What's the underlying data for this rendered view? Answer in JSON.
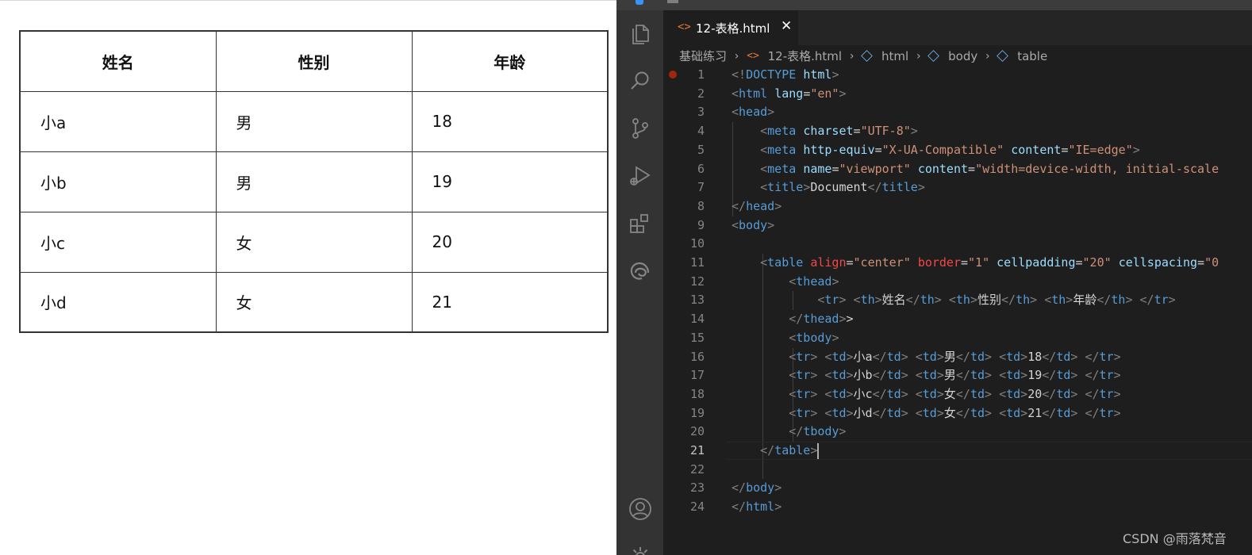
{
  "preview": {
    "table": {
      "headers": [
        "姓名",
        "性别",
        "年龄"
      ],
      "rows": [
        [
          "小a",
          "男",
          "18"
        ],
        [
          "小b",
          "男",
          "19"
        ],
        [
          "小c",
          "女",
          "20"
        ],
        [
          "小d",
          "女",
          "21"
        ]
      ]
    }
  },
  "editor": {
    "tab": {
      "label": "12-表格.html",
      "icon": "html-file-icon"
    },
    "breadcrumb": [
      "基础练习",
      "12-表格.html",
      "html",
      "body",
      "table"
    ],
    "active_line": 21,
    "lines": [
      {
        "n": "1",
        "t": [
          [
            "p",
            "<!"
          ],
          [
            "t",
            "DOCTYPE"
          ],
          [
            "x",
            " "
          ],
          [
            "a",
            "html"
          ],
          [
            "p",
            ">"
          ]
        ]
      },
      {
        "n": "2",
        "t": [
          [
            "p",
            "<"
          ],
          [
            "t",
            "html"
          ],
          [
            "x",
            " "
          ],
          [
            "a",
            "lang"
          ],
          [
            "x",
            "="
          ],
          [
            "v",
            "\"en\""
          ],
          [
            "p",
            ">"
          ]
        ]
      },
      {
        "n": "3",
        "t": [
          [
            "p",
            "<"
          ],
          [
            "t",
            "head"
          ],
          [
            "p",
            ">"
          ]
        ]
      },
      {
        "n": "4",
        "t": [
          [
            "x",
            "    "
          ],
          [
            "p",
            "<"
          ],
          [
            "t",
            "meta"
          ],
          [
            "x",
            " "
          ],
          [
            "a",
            "charset"
          ],
          [
            "x",
            "="
          ],
          [
            "v",
            "\"UTF-8\""
          ],
          [
            "p",
            ">"
          ]
        ]
      },
      {
        "n": "5",
        "t": [
          [
            "x",
            "    "
          ],
          [
            "p",
            "<"
          ],
          [
            "t",
            "meta"
          ],
          [
            "x",
            " "
          ],
          [
            "a",
            "http-equiv"
          ],
          [
            "x",
            "="
          ],
          [
            "v",
            "\"X-UA-Compatible\""
          ],
          [
            "x",
            " "
          ],
          [
            "a",
            "content"
          ],
          [
            "x",
            "="
          ],
          [
            "v",
            "\"IE=edge\""
          ],
          [
            "p",
            ">"
          ]
        ]
      },
      {
        "n": "6",
        "t": [
          [
            "x",
            "    "
          ],
          [
            "p",
            "<"
          ],
          [
            "t",
            "meta"
          ],
          [
            "x",
            " "
          ],
          [
            "a",
            "name"
          ],
          [
            "x",
            "="
          ],
          [
            "v",
            "\"viewport\""
          ],
          [
            "x",
            " "
          ],
          [
            "a",
            "content"
          ],
          [
            "x",
            "="
          ],
          [
            "v",
            "\"width=device-width, initial-scale"
          ]
        ]
      },
      {
        "n": "7",
        "t": [
          [
            "x",
            "    "
          ],
          [
            "p",
            "<"
          ],
          [
            "t",
            "title"
          ],
          [
            "p",
            ">"
          ],
          [
            "x",
            "Document"
          ],
          [
            "p",
            "</"
          ],
          [
            "t",
            "title"
          ],
          [
            "p",
            ">"
          ]
        ]
      },
      {
        "n": "8",
        "t": [
          [
            "p",
            "</"
          ],
          [
            "t",
            "head"
          ],
          [
            "p",
            ">"
          ]
        ]
      },
      {
        "n": "9",
        "t": [
          [
            "p",
            "<"
          ],
          [
            "t",
            "body"
          ],
          [
            "p",
            ">"
          ]
        ]
      },
      {
        "n": "10",
        "t": []
      },
      {
        "n": "11",
        "t": [
          [
            "x",
            "    "
          ],
          [
            "p",
            "<"
          ],
          [
            "t",
            "table"
          ],
          [
            "x",
            " "
          ],
          [
            "r",
            "align"
          ],
          [
            "x",
            "="
          ],
          [
            "v",
            "\"center\""
          ],
          [
            "x",
            " "
          ],
          [
            "r",
            "border"
          ],
          [
            "x",
            "="
          ],
          [
            "v",
            "\"1\""
          ],
          [
            "x",
            " "
          ],
          [
            "a",
            "cellpadding"
          ],
          [
            "x",
            "="
          ],
          [
            "v",
            "\"20\""
          ],
          [
            "x",
            " "
          ],
          [
            "a",
            "cellspacing"
          ],
          [
            "x",
            "="
          ],
          [
            "v",
            "\"0"
          ]
        ]
      },
      {
        "n": "12",
        "t": [
          [
            "x",
            "        "
          ],
          [
            "p",
            "<"
          ],
          [
            "t",
            "thead"
          ],
          [
            "p",
            ">"
          ]
        ]
      },
      {
        "n": "13",
        "t": [
          [
            "x",
            "            "
          ],
          [
            "p",
            "<"
          ],
          [
            "t",
            "tr"
          ],
          [
            "p",
            ">"
          ],
          [
            "x",
            " "
          ],
          [
            "p",
            "<"
          ],
          [
            "t",
            "th"
          ],
          [
            "p",
            ">"
          ],
          [
            "x",
            "姓名"
          ],
          [
            "p",
            "</"
          ],
          [
            "t",
            "th"
          ],
          [
            "p",
            ">"
          ],
          [
            "x",
            " "
          ],
          [
            "p",
            "<"
          ],
          [
            "t",
            "th"
          ],
          [
            "p",
            ">"
          ],
          [
            "x",
            "性别"
          ],
          [
            "p",
            "</"
          ],
          [
            "t",
            "th"
          ],
          [
            "p",
            ">"
          ],
          [
            "x",
            " "
          ],
          [
            "p",
            "<"
          ],
          [
            "t",
            "th"
          ],
          [
            "p",
            ">"
          ],
          [
            "x",
            "年龄"
          ],
          [
            "p",
            "</"
          ],
          [
            "t",
            "th"
          ],
          [
            "p",
            ">"
          ],
          [
            "x",
            " "
          ],
          [
            "p",
            "</"
          ],
          [
            "t",
            "tr"
          ],
          [
            "p",
            ">"
          ]
        ]
      },
      {
        "n": "14",
        "t": [
          [
            "x",
            "        "
          ],
          [
            "p",
            "</"
          ],
          [
            "t",
            "thead"
          ],
          [
            "p",
            ">"
          ],
          [
            "x",
            ">"
          ]
        ]
      },
      {
        "n": "15",
        "t": [
          [
            "x",
            "        "
          ],
          [
            "p",
            "<"
          ],
          [
            "t",
            "tbody"
          ],
          [
            "p",
            ">"
          ]
        ]
      },
      {
        "n": "16",
        "t": [
          [
            "x",
            "        "
          ],
          [
            "p",
            "<"
          ],
          [
            "t",
            "tr"
          ],
          [
            "p",
            ">"
          ],
          [
            "x",
            " "
          ],
          [
            "p",
            "<"
          ],
          [
            "t",
            "td"
          ],
          [
            "p",
            ">"
          ],
          [
            "x",
            "小a"
          ],
          [
            "p",
            "</"
          ],
          [
            "t",
            "td"
          ],
          [
            "p",
            ">"
          ],
          [
            "x",
            " "
          ],
          [
            "p",
            "<"
          ],
          [
            "t",
            "td"
          ],
          [
            "p",
            ">"
          ],
          [
            "x",
            "男"
          ],
          [
            "p",
            "</"
          ],
          [
            "t",
            "td"
          ],
          [
            "p",
            ">"
          ],
          [
            "x",
            " "
          ],
          [
            "p",
            "<"
          ],
          [
            "t",
            "td"
          ],
          [
            "p",
            ">"
          ],
          [
            "x",
            "18"
          ],
          [
            "p",
            "</"
          ],
          [
            "t",
            "td"
          ],
          [
            "p",
            ">"
          ],
          [
            "x",
            " "
          ],
          [
            "p",
            "</"
          ],
          [
            "t",
            "tr"
          ],
          [
            "p",
            ">"
          ]
        ]
      },
      {
        "n": "17",
        "t": [
          [
            "x",
            "        "
          ],
          [
            "p",
            "<"
          ],
          [
            "t",
            "tr"
          ],
          [
            "p",
            ">"
          ],
          [
            "x",
            " "
          ],
          [
            "p",
            "<"
          ],
          [
            "t",
            "td"
          ],
          [
            "p",
            ">"
          ],
          [
            "x",
            "小b"
          ],
          [
            "p",
            "</"
          ],
          [
            "t",
            "td"
          ],
          [
            "p",
            ">"
          ],
          [
            "x",
            " "
          ],
          [
            "p",
            "<"
          ],
          [
            "t",
            "td"
          ],
          [
            "p",
            ">"
          ],
          [
            "x",
            "男"
          ],
          [
            "p",
            "</"
          ],
          [
            "t",
            "td"
          ],
          [
            "p",
            ">"
          ],
          [
            "x",
            " "
          ],
          [
            "p",
            "<"
          ],
          [
            "t",
            "td"
          ],
          [
            "p",
            ">"
          ],
          [
            "x",
            "19"
          ],
          [
            "p",
            "</"
          ],
          [
            "t",
            "td"
          ],
          [
            "p",
            ">"
          ],
          [
            "x",
            " "
          ],
          [
            "p",
            "</"
          ],
          [
            "t",
            "tr"
          ],
          [
            "p",
            ">"
          ]
        ]
      },
      {
        "n": "18",
        "t": [
          [
            "x",
            "        "
          ],
          [
            "p",
            "<"
          ],
          [
            "t",
            "tr"
          ],
          [
            "p",
            ">"
          ],
          [
            "x",
            " "
          ],
          [
            "p",
            "<"
          ],
          [
            "t",
            "td"
          ],
          [
            "p",
            ">"
          ],
          [
            "x",
            "小c"
          ],
          [
            "p",
            "</"
          ],
          [
            "t",
            "td"
          ],
          [
            "p",
            ">"
          ],
          [
            "x",
            " "
          ],
          [
            "p",
            "<"
          ],
          [
            "t",
            "td"
          ],
          [
            "p",
            ">"
          ],
          [
            "x",
            "女"
          ],
          [
            "p",
            "</"
          ],
          [
            "t",
            "td"
          ],
          [
            "p",
            ">"
          ],
          [
            "x",
            " "
          ],
          [
            "p",
            "<"
          ],
          [
            "t",
            "td"
          ],
          [
            "p",
            ">"
          ],
          [
            "x",
            "20"
          ],
          [
            "p",
            "</"
          ],
          [
            "t",
            "td"
          ],
          [
            "p",
            ">"
          ],
          [
            "x",
            " "
          ],
          [
            "p",
            "</"
          ],
          [
            "t",
            "tr"
          ],
          [
            "p",
            ">"
          ]
        ]
      },
      {
        "n": "19",
        "t": [
          [
            "x",
            "        "
          ],
          [
            "p",
            "<"
          ],
          [
            "t",
            "tr"
          ],
          [
            "p",
            ">"
          ],
          [
            "x",
            " "
          ],
          [
            "p",
            "<"
          ],
          [
            "t",
            "td"
          ],
          [
            "p",
            ">"
          ],
          [
            "x",
            "小d"
          ],
          [
            "p",
            "</"
          ],
          [
            "t",
            "td"
          ],
          [
            "p",
            ">"
          ],
          [
            "x",
            " "
          ],
          [
            "p",
            "<"
          ],
          [
            "t",
            "td"
          ],
          [
            "p",
            ">"
          ],
          [
            "x",
            "女"
          ],
          [
            "p",
            "</"
          ],
          [
            "t",
            "td"
          ],
          [
            "p",
            ">"
          ],
          [
            "x",
            " "
          ],
          [
            "p",
            "<"
          ],
          [
            "t",
            "td"
          ],
          [
            "p",
            ">"
          ],
          [
            "x",
            "21"
          ],
          [
            "p",
            "</"
          ],
          [
            "t",
            "td"
          ],
          [
            "p",
            ">"
          ],
          [
            "x",
            " "
          ],
          [
            "p",
            "</"
          ],
          [
            "t",
            "tr"
          ],
          [
            "p",
            ">"
          ]
        ]
      },
      {
        "n": "20",
        "t": [
          [
            "x",
            "        "
          ],
          [
            "p",
            "</"
          ],
          [
            "t",
            "tbody"
          ],
          [
            "p",
            ">"
          ]
        ]
      },
      {
        "n": "21",
        "t": [
          [
            "x",
            "    "
          ],
          [
            "p",
            "</"
          ],
          [
            "t",
            "table"
          ],
          [
            "p",
            ">"
          ]
        ]
      },
      {
        "n": "22",
        "t": []
      },
      {
        "n": "23",
        "t": [
          [
            "p",
            "</"
          ],
          [
            "t",
            "body"
          ],
          [
            "p",
            ">"
          ]
        ]
      },
      {
        "n": "24",
        "t": [
          [
            "p",
            "</"
          ],
          [
            "t",
            "html"
          ],
          [
            "p",
            ">"
          ]
        ]
      }
    ]
  },
  "watermark": "CSDN @雨落梵音",
  "colors": {
    "tag": "#569cd6",
    "punct": "#808080",
    "attr": "#9cdcfe",
    "string": "#ce9178",
    "deprecated_attr": "#f44747",
    "editor_bg": "#1e1e1e",
    "activity_bg": "#333333"
  }
}
